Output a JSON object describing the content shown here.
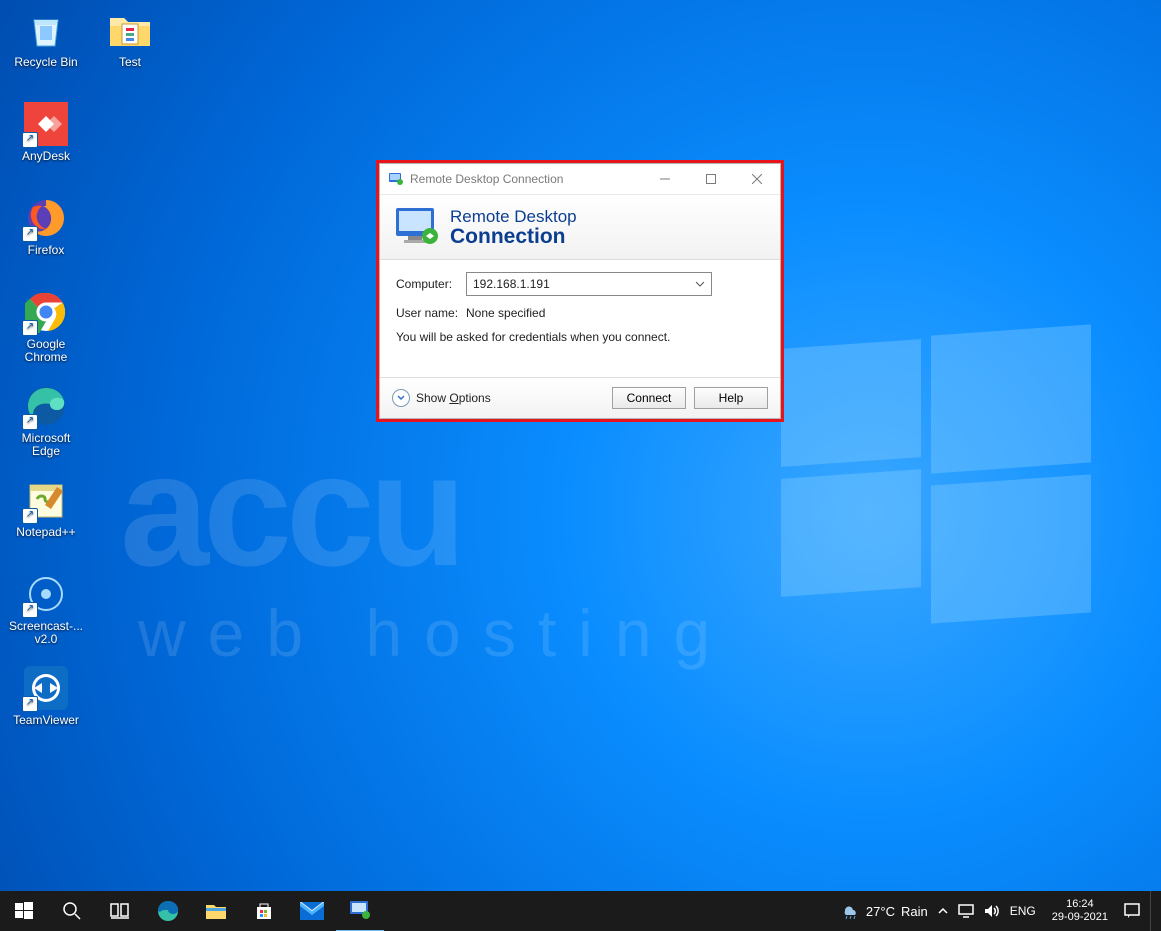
{
  "desktop_icons_col": [
    {
      "label": "Recycle Bin",
      "name": "recycle-bin"
    },
    {
      "label": "AnyDesk",
      "name": "anydesk"
    },
    {
      "label": "Firefox",
      "name": "firefox"
    },
    {
      "label": "Google\nChrome",
      "name": "google-chrome"
    },
    {
      "label": "Microsoft\nEdge",
      "name": "microsoft-edge"
    },
    {
      "label": "Notepad++",
      "name": "notepad-pp"
    },
    {
      "label": "Screencast-...\nv2.0",
      "name": "screencast"
    },
    {
      "label": "TeamViewer",
      "name": "teamviewer"
    }
  ],
  "desktop_icons_row2": [
    {
      "label": "Test",
      "name": "test-folder"
    }
  ],
  "watermark": {
    "top": "accu",
    "bottom": "web  hosting"
  },
  "rdp": {
    "title": "Remote Desktop Connection",
    "banner_l1": "Remote Desktop",
    "banner_l2": "Connection",
    "computer_label": "Computer:",
    "computer_value": "192.168.1.191",
    "user_label": "User name:",
    "user_value": "None specified",
    "note": "You will be asked for credentials when you connect.",
    "show_options": "Show Options",
    "connect": "Connect",
    "help": "Help"
  },
  "taskbar": {
    "weather_temp": "27°C",
    "weather_cond": "Rain",
    "lang": "ENG",
    "time": "16:24",
    "date": "29-09-2021"
  }
}
